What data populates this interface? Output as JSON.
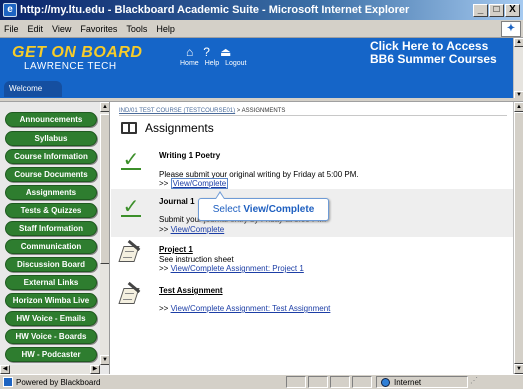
{
  "window": {
    "title": "http://my.ltu.edu - Blackboard Academic Suite - Microsoft Internet Explorer",
    "minimize": "_",
    "maximize": "□",
    "close": "X"
  },
  "menubar": [
    "File",
    "Edit",
    "View",
    "Favorites",
    "Tools",
    "Help"
  ],
  "banner": {
    "logo_line1": "GET ON BOARD",
    "logo_line2": "LAWRENCE TECH",
    "links": [
      "Home",
      "Help",
      "Logout"
    ],
    "promo_line1": "Click Here to Access",
    "promo_line2": "BB6 Summer Courses",
    "welcome_tab": "Welcome",
    "accent_color": "#1565c8"
  },
  "nav": {
    "button_color": "#2e7d2f",
    "items": [
      "Announcements",
      "Syllabus",
      "Course Information",
      "Course Documents",
      "Assignments",
      "Tests & Quizzes",
      "Staff Information",
      "Communication",
      "Discussion Board",
      "External Links",
      "Horizon Wimba Live",
      "HW Voice - Emails",
      "HW Voice - Boards",
      "HW - Podcaster"
    ]
  },
  "content": {
    "breadcrumb_course": "IND/01 TEST COURSE (TESTCOURSE01)",
    "breadcrumb_sep": " > ",
    "breadcrumb_current": "ASSIGNMENTS",
    "page_title": "Assignments",
    "items": [
      {
        "icon": "checkmark-icon",
        "title": "Writing 1 Poetry",
        "desc": "Please submit your original writing by Friday at 5:00 PM.",
        "link_prefix": ">> ",
        "link_text": "View/Complete"
      },
      {
        "icon": "checkmark-icon",
        "title": "Journal 1",
        "desc": "Submit your journal entry by Friday at 5:00 PM.",
        "link_prefix": ">> ",
        "link_text": "View/Complete"
      },
      {
        "icon": "assignment-doc-icon",
        "title": "Project 1",
        "desc": "See instruction sheet",
        "link_prefix": ">> ",
        "link_text": "View/Complete Assignment: Project 1"
      },
      {
        "icon": "assignment-doc-icon",
        "title": "Test Assignment",
        "desc": "",
        "link_prefix": ">> ",
        "link_text": "View/Complete Assignment: Test Assignment"
      }
    ],
    "callout_prefix": "Select ",
    "callout_bold": "View/Complete"
  },
  "statusbar": {
    "text": "Powered by Blackboard",
    "zone": "Internet"
  }
}
